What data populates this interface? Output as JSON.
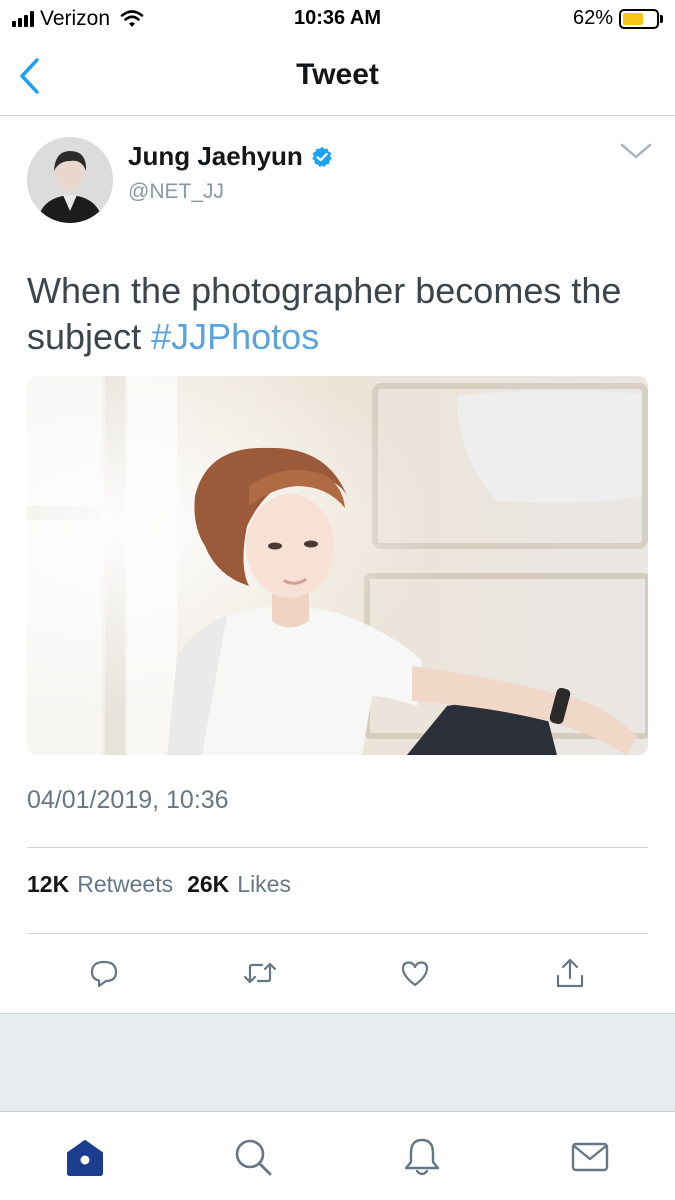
{
  "status_bar": {
    "carrier": "Verizon",
    "time": "10:36 AM",
    "battery_percent": "62%",
    "battery_level": 0.62,
    "battery_color": "#f5c518"
  },
  "nav": {
    "back_icon": "chevron-left-icon",
    "title": "Tweet"
  },
  "tweet": {
    "author": {
      "name": "Jung Jaehyun",
      "handle": "@NET_JJ",
      "verified": true
    },
    "text": "When the photographer becomes the subject",
    "hashtag": "#JJPhotos",
    "timestamp": "04/01/2019, 10:36",
    "stats": {
      "retweets_count": "12K",
      "retweets_label": "Retweets",
      "likes_count": "26K",
      "likes_label": "Likes"
    },
    "actions": [
      "reply-icon",
      "retweet-icon",
      "like-icon",
      "share-icon"
    ]
  },
  "tab_bar": {
    "tabs": [
      "home-icon",
      "search-icon",
      "notifications-icon",
      "messages-icon"
    ],
    "active": "home-icon"
  },
  "colors": {
    "accent": "#1da1f2",
    "hashtag": "#5aa3dd",
    "icon_gray": "#657786",
    "tab_active": "#1b3d8f",
    "background_band": "#e6ecf0"
  }
}
